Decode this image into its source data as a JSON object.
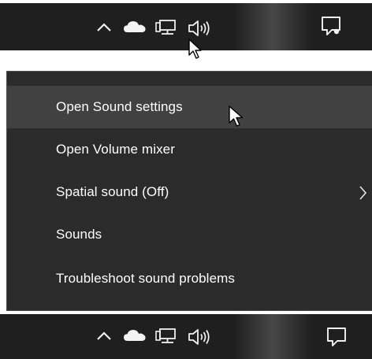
{
  "menu": {
    "items": [
      {
        "label": "Open Sound settings",
        "state": "hovered"
      },
      {
        "label": "Open Volume mixer"
      },
      {
        "label": "Spatial sound (Off)",
        "has_submenu": true
      },
      {
        "label": "Sounds"
      },
      {
        "label": "Troubleshoot sound problems"
      }
    ]
  },
  "taskbar": {
    "tray_icons": [
      "chevron-up-icon",
      "onedrive-cloud-icon",
      "network-icon",
      "volume-icon",
      "action-center-icon"
    ]
  },
  "colors": {
    "taskbar_bg": "#1f1f1f",
    "menu_bg": "#2b2b2b",
    "menu_hover_bg": "#414141",
    "menu_text": "#ffffff"
  }
}
